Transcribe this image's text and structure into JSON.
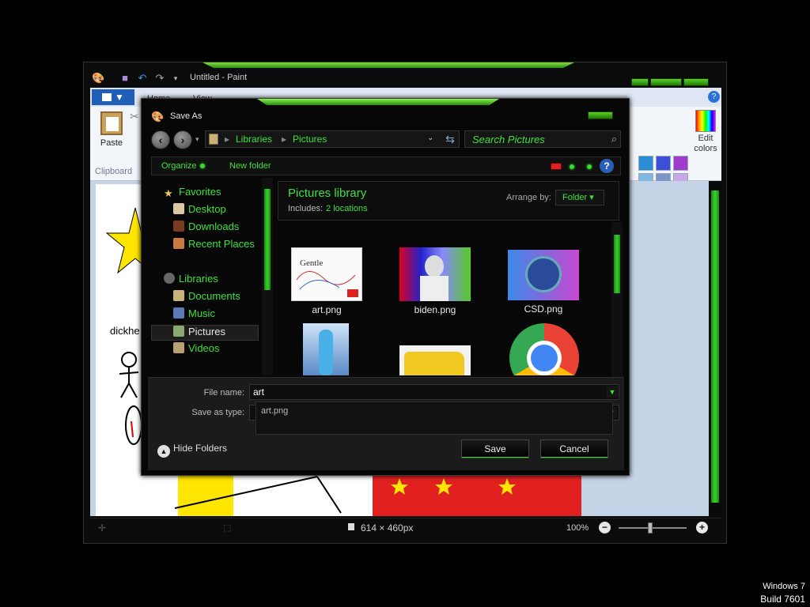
{
  "paint": {
    "window_title": "Untitled - Paint",
    "tabs": [
      "Home",
      "View"
    ],
    "file_tab_glyph": "▼",
    "paste_label": "Paste",
    "clipboard_label": "Clipboard",
    "edit_colors_label": "Edit colors",
    "canvas_caption": "dickhe",
    "status_dims": "614 × 460px",
    "zoom_level": "100%",
    "zoom_out": "−",
    "zoom_in": "+",
    "palette_colors": [
      "#2b8cd6",
      "#3c4fd8",
      "#9f3ccc",
      "#7fb8e0",
      "#7a96c8",
      "#c8a8e6"
    ]
  },
  "dialog": {
    "title": "Save As",
    "breadcrumb": [
      "Libraries",
      "Pictures"
    ],
    "search_placeholder": "Search Pictures",
    "toolbar": {
      "organize": "Organize",
      "new_folder": "New folder",
      "help": "?"
    },
    "nav": {
      "favorites": "Favorites",
      "favorites_items": [
        "Desktop",
        "Downloads",
        "Recent Places"
      ],
      "libraries": "Libraries",
      "library_items": [
        "Documents",
        "Music",
        "Pictures",
        "Videos"
      ],
      "selected": "Pictures"
    },
    "library_header": {
      "title": "Pictures library",
      "includes_label": "Includes:",
      "locations": "2 locations",
      "arrange_label": "Arrange by:",
      "arrange_value": "Folder"
    },
    "files": [
      {
        "name": "art.png"
      },
      {
        "name": "biden.png"
      },
      {
        "name": "CSD.png"
      }
    ],
    "form": {
      "filename_label": "File name:",
      "filename_value": "art",
      "savetype_label": "Save as type:",
      "autocomplete_option": "art.png",
      "hide_folders": "Hide Folders",
      "save": "Save",
      "cancel": "Cancel"
    }
  },
  "watermark": {
    "line1": "Windows 7",
    "line2": "Build 7601"
  },
  "accent_colors": {
    "green": "#3de23d",
    "bar": "#36d22a"
  }
}
